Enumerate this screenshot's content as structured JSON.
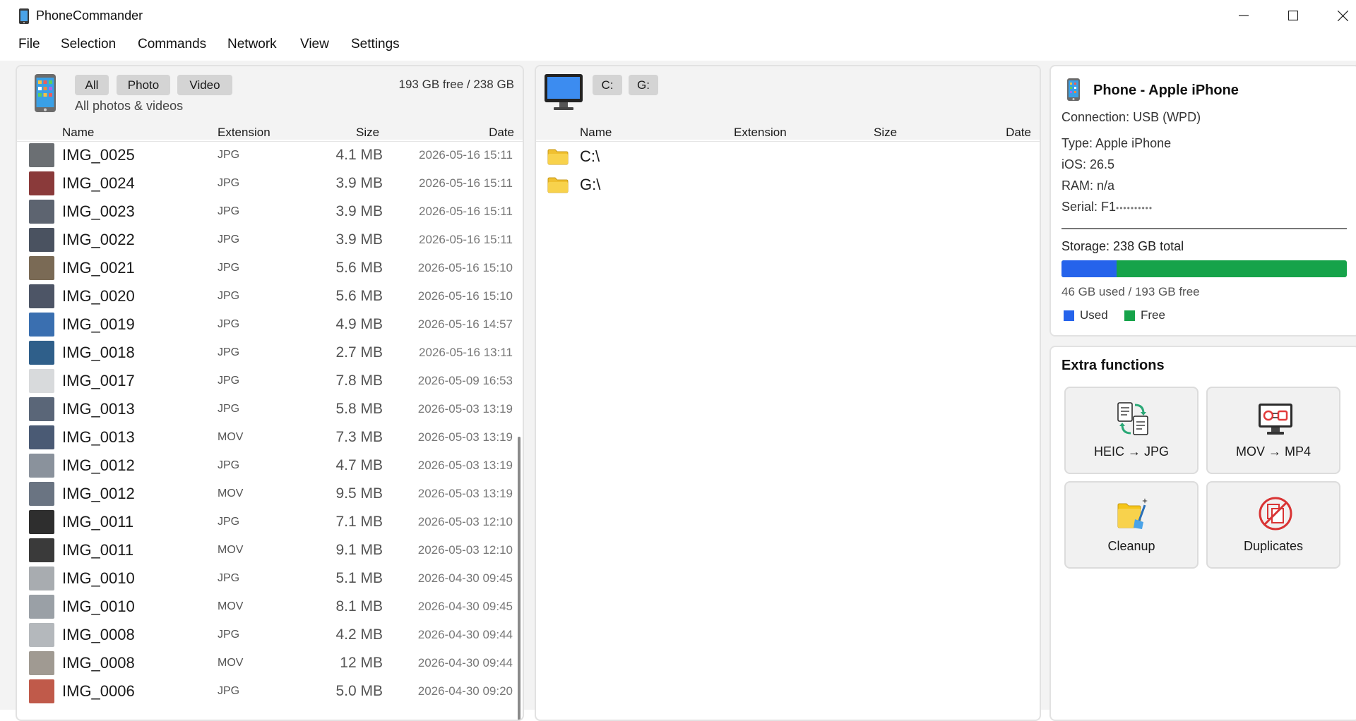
{
  "window": {
    "title": "PhoneCommander"
  },
  "menu": [
    "File",
    "Selection",
    "Commands",
    "Network",
    "View",
    "Settings"
  ],
  "phone_panel": {
    "filters": [
      "All",
      "Photo",
      "Video"
    ],
    "subtitle": "All photos & videos",
    "free_space": "193 GB free / 238 GB",
    "columns": {
      "name": "Name",
      "extension": "Extension",
      "size": "Size",
      "date": "Date"
    },
    "files": [
      {
        "name": "IMG_0025",
        "ext": "JPG",
        "size": "4.1 MB",
        "date": "2026-05-16 15:11"
      },
      {
        "name": "IMG_0024",
        "ext": "JPG",
        "size": "3.9 MB",
        "date": "2026-05-16 15:11"
      },
      {
        "name": "IMG_0023",
        "ext": "JPG",
        "size": "3.9 MB",
        "date": "2026-05-16 15:11"
      },
      {
        "name": "IMG_0022",
        "ext": "JPG",
        "size": "3.9 MB",
        "date": "2026-05-16 15:11"
      },
      {
        "name": "IMG_0021",
        "ext": "JPG",
        "size": "5.6 MB",
        "date": "2026-05-16 15:10"
      },
      {
        "name": "IMG_0020",
        "ext": "JPG",
        "size": "5.6 MB",
        "date": "2026-05-16 15:10"
      },
      {
        "name": "IMG_0019",
        "ext": "JPG",
        "size": "4.9 MB",
        "date": "2026-05-16 14:57"
      },
      {
        "name": "IMG_0018",
        "ext": "JPG",
        "size": "2.7 MB",
        "date": "2026-05-16 13:11"
      },
      {
        "name": "IMG_0017",
        "ext": "JPG",
        "size": "7.8 MB",
        "date": "2026-05-09 16:53"
      },
      {
        "name": "IMG_0013",
        "ext": "JPG",
        "size": "5.8 MB",
        "date": "2026-05-03 13:19"
      },
      {
        "name": "IMG_0013",
        "ext": "MOV",
        "size": "7.3 MB",
        "date": "2026-05-03 13:19"
      },
      {
        "name": "IMG_0012",
        "ext": "JPG",
        "size": "4.7 MB",
        "date": "2026-05-03 13:19"
      },
      {
        "name": "IMG_0012",
        "ext": "MOV",
        "size": "9.5 MB",
        "date": "2026-05-03 13:19"
      },
      {
        "name": "IMG_0011",
        "ext": "JPG",
        "size": "7.1 MB",
        "date": "2026-05-03 12:10"
      },
      {
        "name": "IMG_0011",
        "ext": "MOV",
        "size": "9.1 MB",
        "date": "2026-05-03 12:10"
      },
      {
        "name": "IMG_0010",
        "ext": "JPG",
        "size": "5.1 MB",
        "date": "2026-04-30 09:45"
      },
      {
        "name": "IMG_0010",
        "ext": "MOV",
        "size": "8.1 MB",
        "date": "2026-04-30 09:45"
      },
      {
        "name": "IMG_0008",
        "ext": "JPG",
        "size": "4.2 MB",
        "date": "2026-04-30 09:44"
      },
      {
        "name": "IMG_0008",
        "ext": "MOV",
        "size": "12 MB",
        "date": "2026-04-30 09:44"
      },
      {
        "name": "IMG_0006",
        "ext": "JPG",
        "size": "5.0 MB",
        "date": "2026-04-30 09:20"
      }
    ],
    "thumb_colors": [
      "#6b6f73",
      "#8a3a3a",
      "#5d6470",
      "#4a5260",
      "#7a6a55",
      "#4d5566",
      "#3a6fb0",
      "#2f5f8a",
      "#d8dadc",
      "#5a6678",
      "#4a5a74",
      "#8a929c",
      "#6a7482",
      "#2e2e2e",
      "#3a3a3a",
      "#a8acb0",
      "#9aa0a6",
      "#b4b8bc",
      "#a09a92",
      "#c05a4a"
    ]
  },
  "pc_panel": {
    "drives": [
      "C:",
      "G:"
    ],
    "columns": {
      "name": "Name",
      "extension": "Extension",
      "size": "Size",
      "date": "Date"
    },
    "items": [
      "C:\\",
      "G:\\"
    ]
  },
  "device": {
    "title": "Phone - Apple iPhone",
    "connection": "Connection: USB (WPD)",
    "type": "Type: Apple iPhone",
    "ios": "iOS: 26.5",
    "ram": "RAM: n/a",
    "serial": "Serial: F1",
    "serial_mask": "••••••••••",
    "storage_label": "Storage: 238 GB total",
    "storage_used_fraction": 0.193,
    "storage_text": "46 GB used / 193 GB free",
    "legend_used": "Used",
    "legend_free": "Free",
    "color_used": "#2563eb",
    "color_free": "#16a34a"
  },
  "extra": {
    "title": "Extra functions",
    "buttons": [
      {
        "label": "HEIC → JPG",
        "icon": "convert-heic-icon"
      },
      {
        "label": "MOV → MP4",
        "icon": "convert-video-icon"
      },
      {
        "label": "Cleanup",
        "icon": "cleanup-icon"
      },
      {
        "label": "Duplicates",
        "icon": "duplicates-icon"
      }
    ]
  }
}
